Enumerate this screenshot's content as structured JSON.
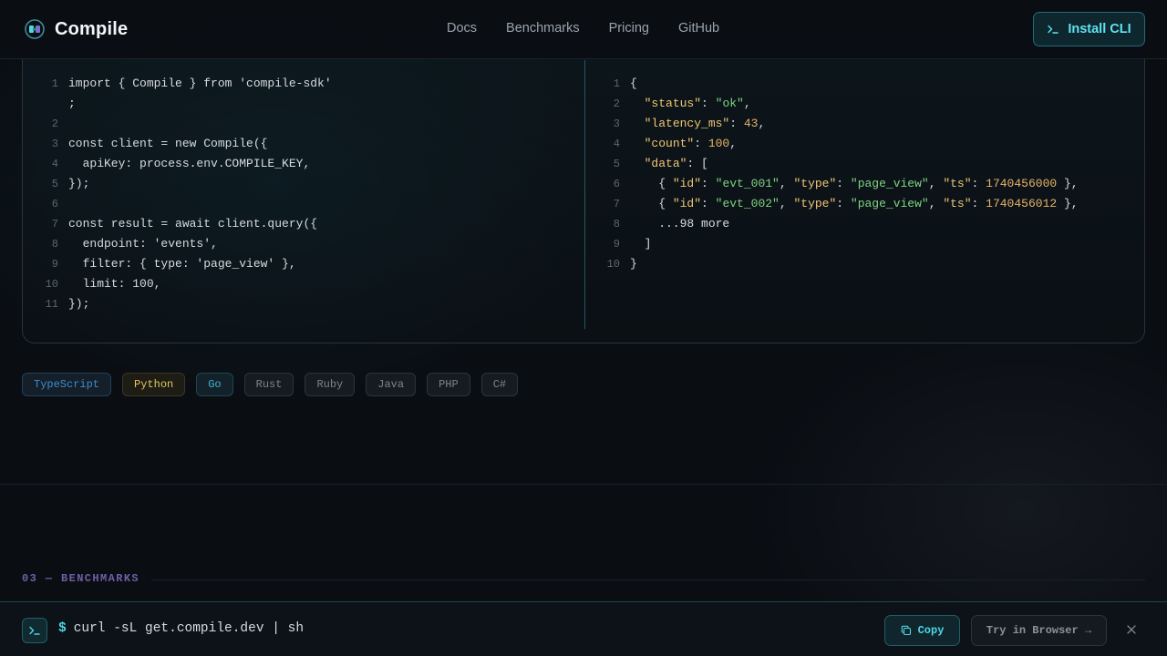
{
  "header": {
    "brand": "Compile",
    "nav": [
      "Docs",
      "Benchmarks",
      "Pricing",
      "GitHub"
    ],
    "install_label": "Install CLI"
  },
  "code_left": {
    "lines": [
      {
        "n": "1",
        "t": "import { Compile } from 'compile-sdk'"
      },
      {
        "n": "",
        "t": ";"
      },
      {
        "n": "2",
        "t": ""
      },
      {
        "n": "3",
        "t": "const client = new Compile({"
      },
      {
        "n": "4",
        "t": "  apiKey: process.env.COMPILE_KEY,"
      },
      {
        "n": "5",
        "t": "});"
      },
      {
        "n": "6",
        "t": ""
      },
      {
        "n": "7",
        "t": "const result = await client.query({"
      },
      {
        "n": "8",
        "t": "  endpoint: 'events',"
      },
      {
        "n": "9",
        "t": "  filter: { type: 'page_view' },"
      },
      {
        "n": "10",
        "t": "  limit: 100,"
      },
      {
        "n": "11",
        "t": "});"
      }
    ]
  },
  "code_right": {
    "lines": [
      {
        "n": "1",
        "t": "{"
      },
      {
        "n": "2",
        "t": "  \"status\": \"ok\","
      },
      {
        "n": "3",
        "t": "  \"latency_ms\": 43,"
      },
      {
        "n": "4",
        "t": "  \"count\": 100,"
      },
      {
        "n": "5",
        "t": "  \"data\": ["
      },
      {
        "n": "6",
        "t": "    { \"id\": \"evt_001\", \"type\": \"page_view\", \"ts\": 1740456000 },"
      },
      {
        "n": "7",
        "t": "    { \"id\": \"evt_002\", \"type\": \"page_view\", \"ts\": 1740456012 },"
      },
      {
        "n": "8",
        "t": "    ...98 more"
      },
      {
        "n": "9",
        "t": "  ]"
      },
      {
        "n": "10",
        "t": "}"
      }
    ]
  },
  "languages": [
    "TypeScript",
    "Python",
    "Go",
    "Rust",
    "Ruby",
    "Java",
    "PHP",
    "C#"
  ],
  "section": {
    "label": "03 — BENCHMARKS"
  },
  "bottom_bar": {
    "prompt": "$",
    "command": "curl -sL get.compile.dev | sh",
    "copy_label": "Copy",
    "try_label": "Try in Browser →"
  },
  "colors": {
    "accent": "#4fd6e6",
    "background": "#0a0e13",
    "section_label": "#6f5fa8"
  },
  "icons": {
    "logo": "compile-logo-icon",
    "install": "terminal-prompt-icon",
    "copy": "copy-icon",
    "close": "close-icon"
  }
}
